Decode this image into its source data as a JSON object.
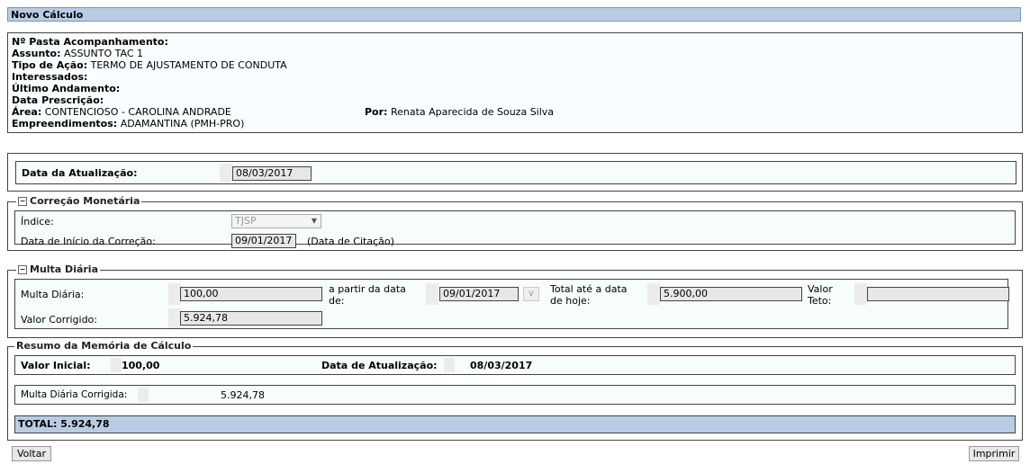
{
  "title": "Novo Cálculo",
  "info": {
    "pasta_label": "Nº Pasta Acompanhamento:",
    "pasta_value": "",
    "assunto_label": "Assunto:",
    "assunto_value": "ASSUNTO TAC 1",
    "tipo_label": "Tipo de Ação:",
    "tipo_value": "TERMO DE AJUSTAMENTO DE CONDUTA",
    "interessados_label": "Interessados:",
    "ultimo_label": "Último Andamento:",
    "prescricao_label": "Data Prescrição:",
    "area_label": "Área:",
    "area_value": "CONTENCIOSO - CAROLINA ANDRADE",
    "por_label": "Por:",
    "por_value": "Renata Aparecida de Souza Silva",
    "empreend_label": "Empreendimentos:",
    "empreend_value": "ADAMANTINA (PMH-PRO)"
  },
  "atualizacao": {
    "label": "Data da Atualização:",
    "value": "08/03/2017"
  },
  "correcao": {
    "legend": "Correção Monetária",
    "indice_label": "Índice:",
    "indice_value": "TJSP",
    "inicio_label": "Data de Início da Correção:",
    "inicio_value": "09/01/2017",
    "inicio_note": "(Data de Citação)"
  },
  "multa": {
    "legend": "Multa Diária",
    "multa_label": "Multa Diária:",
    "multa_value": "100,00",
    "apartir_label_1": "a partir da data",
    "apartir_label_2": "de:",
    "apartir_value": "09/01/2017",
    "cal_label": "v",
    "total_label_1": "Total até a data",
    "total_label_2": "de hoje:",
    "total_value": "5.900,00",
    "teto_label_1": "Valor",
    "teto_label_2": "Teto:",
    "teto_value": "",
    "corrigido_label": "Valor Corrigido:",
    "corrigido_value": "5.924,78"
  },
  "resumo": {
    "legend": "Resumo da Memória de Cálculo",
    "valor_inicial_label": "Valor Inicial:",
    "valor_inicial_value": "100,00",
    "data_atual_label": "Data de Atualização:",
    "data_atual_value": "08/03/2017",
    "multa_corr_label": "Multa Diária Corrigida:",
    "multa_corr_value": "5.924,78",
    "total": "TOTAL: 5.924,78"
  },
  "buttons": {
    "voltar": "Voltar",
    "imprimir": "Imprimir"
  }
}
